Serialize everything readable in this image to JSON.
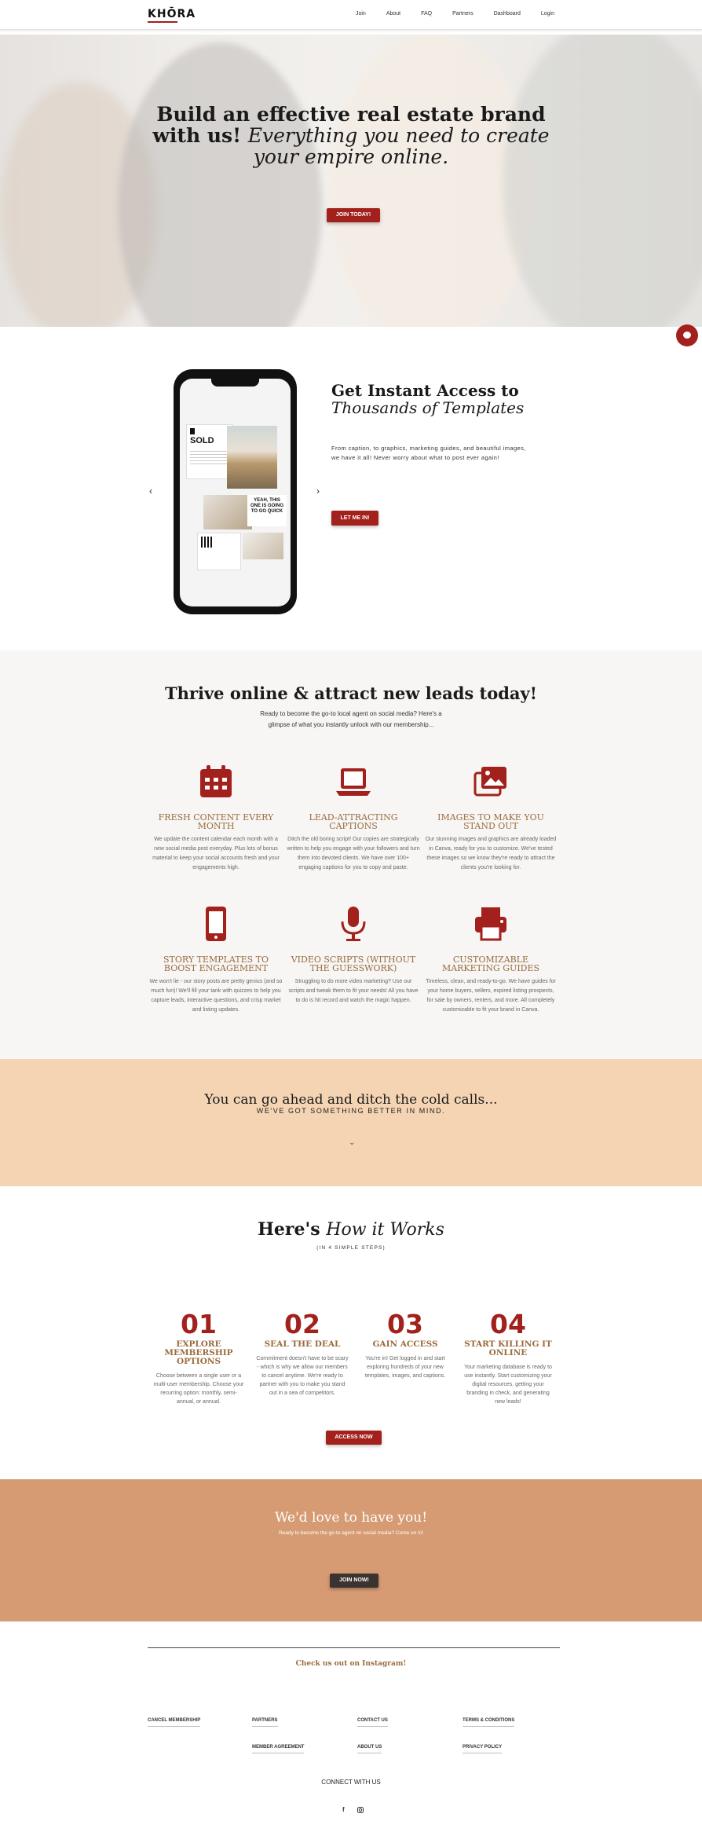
{
  "header": {
    "logo": "KHŌRA",
    "nav": [
      "Join",
      "About",
      "FAQ",
      "Partners",
      "Dashboard",
      "Login"
    ]
  },
  "hero": {
    "title_line": "Build an effective real estate brand with us!",
    "title_italic": "Everything you need to create your empire online.",
    "button": "JOIN TODAY!"
  },
  "access": {
    "title_line": "Get Instant Access to",
    "title_italic": "Thousands of Templates",
    "text": "From caption, to graphics, marketing guides, and beautiful images, we have it all! Never worry about what to post ever again!",
    "button": "LET ME IN!",
    "phone_sold": "SOLD",
    "phone_promo": "YEAH, THIS ONE IS GOING TO GO QUICK"
  },
  "thrive": {
    "title": "Thrive online & attract new leads today!",
    "subtitle": "Ready to become the go-to local agent on social media? Here's a glimpse of what you instantly unlock with our membership...",
    "features": [
      {
        "icon": "calendar-icon",
        "title": "FRESH CONTENT EVERY MONTH",
        "text": "We update the content calendar each month with a new social media post everyday. Plus lots of bonus material to keep your social accounts fresh and your engagements high."
      },
      {
        "icon": "laptop-icon",
        "title": "LEAD-ATTRACTING CAPTIONS",
        "text": "Ditch the old boring script! Our copies are strategically written to help you engage with your followers and turn them into devoted clients. We have over 100+ engaging captions for you to copy and paste."
      },
      {
        "icon": "images-icon",
        "title": "IMAGES TO MAKE YOU STAND OUT",
        "text": "Our stunning images and graphics are already loaded in Canva, ready for you to customize. We've tested these images so we know they're ready to attract the clients you're looking for."
      },
      {
        "icon": "smartphone-icon",
        "title": "STORY TEMPLATES TO BOOST ENGAGEMENT",
        "text": "We won't lie - our story posts are pretty genius (and so much fun)! We'll fill your tank with quizzes to help you capture leads, interactive questions, and crisp market and listing updates."
      },
      {
        "icon": "microphone-icon",
        "title": "VIDEO SCRIPTS (WITHOUT THE GUESSWORK)",
        "text": "Struggling to do more video marketing? Use our scripts and tweak them to fit your needs! All you have to do is hit record and watch the magic happen."
      },
      {
        "icon": "printer-icon",
        "title": "CUSTOMIZABLE MARKETING GUIDES",
        "text": "Timeless, clean, and ready-to-go. We have guides for your home buyers, sellers, expired listing prospects, for sale by owners, renters, and more. All completely customizable to fit your brand in Canva."
      }
    ]
  },
  "cold": {
    "title": "You can go ahead and ditch the cold calls...",
    "subtitle": "WE'VE GOT SOMETHING BETTER IN MIND."
  },
  "how": {
    "title_plain": "Here's",
    "title_italic": "How it Works",
    "subtitle": "(IN 4 SIMPLE STEPS)",
    "steps": [
      {
        "num": "01",
        "title": "EXPLORE MEMBERSHIP OPTIONS",
        "text": "Choose between a single user or a multi-user membership. Choose your recurring option: monthly, semi-annual, or annual."
      },
      {
        "num": "02",
        "title": "SEAL THE DEAL",
        "text": "Commitment doesn't have to be scary - which is why we allow our members to cancel anytime. We're ready to partner with you to make you stand out in a sea of competitors."
      },
      {
        "num": "03",
        "title": "GAIN ACCESS",
        "text": "You're in! Get logged in and start exploring hundreds of your new templates, images, and captions."
      },
      {
        "num": "04",
        "title": "START KILLING IT ONLINE",
        "text": "Your marketing database is ready to use instantly. Start customizing your digital resources, getting your branding in check, and generating new leads!"
      }
    ],
    "button": "ACCESS NOW"
  },
  "love": {
    "title": "We'd love to have you!",
    "subtitle": "Ready to become the go-to agent on social media? Come on in!",
    "button": "JOIN NOW!"
  },
  "footer": {
    "instagram": "Check us out on Instagram!",
    "links": [
      "CANCEL MEMBERSHIP",
      "PARTNERS",
      "CONTACT US",
      "TERMS & CONDITIONS",
      "MEMBER AGREEMENT",
      "ABOUT US",
      "PRIVACY POLICY"
    ],
    "connect": "CONNECT WITH US",
    "social": [
      "facebook-icon",
      "instagram-icon"
    ]
  },
  "colors": {
    "brand_red": "#a2211c",
    "gold": "#9a6b3d",
    "peach": "#f4d4b3",
    "terracotta": "#d69b73",
    "dark_button": "#3a332f"
  }
}
